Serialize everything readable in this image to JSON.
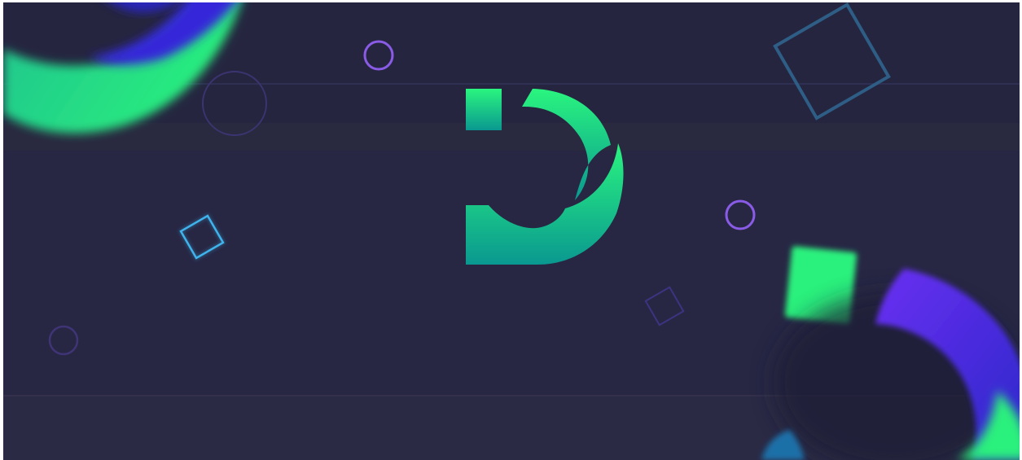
{
  "banner": {
    "type": "decorative-brand-banner",
    "logo": {
      "icon_name": "d-letter-logo-icon",
      "gradient_top": "#2AF57F",
      "gradient_bottom": "#0A9890"
    },
    "colors": {
      "background": "#262641",
      "background_bands": "#2A2A45",
      "stripe": "#2E2F52",
      "accent_green": "#2AF07D",
      "accent_teal": "#1FA796",
      "accent_violet": "#5F2DF0",
      "accent_indigo": "#2B28C9",
      "outline_purple": "#7A53DE",
      "outline_cyan": "#3FB3EC",
      "outline_steel": "#2E5D86"
    },
    "decorations": [
      "blurred-crescent-shape-icon",
      "blurred-square-shape-icon",
      "circle-outline-icon",
      "square-outline-icon"
    ]
  }
}
